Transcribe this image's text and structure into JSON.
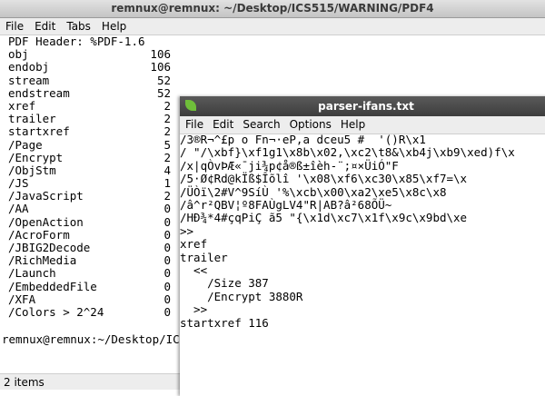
{
  "window": {
    "title": "remnux@remnux: ~/Desktop/ICS515/WARNING/PDF4"
  },
  "menu": {
    "file": "File",
    "edit": "Edit",
    "tabs": "Tabs",
    "help": "Help"
  },
  "terminal": {
    "header": "PDF Header: %PDF-1.6",
    "rows": [
      {
        "key": "obj",
        "value": "106"
      },
      {
        "key": "endobj",
        "value": "106"
      },
      {
        "key": "stream",
        "value": "52"
      },
      {
        "key": "endstream",
        "value": "52"
      },
      {
        "key": "xref",
        "value": "2"
      },
      {
        "key": "trailer",
        "value": "2"
      },
      {
        "key": "startxref",
        "value": "2"
      },
      {
        "key": "/Page",
        "value": "5"
      },
      {
        "key": "/Encrypt",
        "value": "2"
      },
      {
        "key": "/ObjStm",
        "value": "4"
      },
      {
        "key": "/JS",
        "value": "1"
      },
      {
        "key": "/JavaScript",
        "value": "2"
      },
      {
        "key": "/AA",
        "value": "0"
      },
      {
        "key": "/OpenAction",
        "value": "0"
      },
      {
        "key": "/AcroForm",
        "value": "0"
      },
      {
        "key": "/JBIG2Decode",
        "value": "0"
      },
      {
        "key": "/RichMedia",
        "value": "0"
      },
      {
        "key": "/Launch",
        "value": "0"
      },
      {
        "key": "/EmbeddedFile",
        "value": "0"
      },
      {
        "key": "/XFA",
        "value": "0"
      },
      {
        "key": "/Colors > 2^24",
        "value": "0"
      }
    ],
    "prompt": "remnux@remnux:~/Desktop/ICS"
  },
  "status": {
    "text": "2 items"
  },
  "editor": {
    "title": "parser-ifans.txt",
    "menu": {
      "file": "File",
      "edit": "Edit",
      "search": "Search",
      "options": "Options",
      "help": "Help"
    },
    "lines": [
      "/3®R¬^£p o Fn¬·eP,a dceu5 #  '()R\\x1",
      "/ \"/\\xbf}\\xf1g1\\x8b\\x02,\\xc2\\t8&\\xb4j\\xb9\\xed)f\\x",
      "/x|qÒvÞÆ«¯ji¾p¢å®ß±îèh-¨;¤×ÜiÓ\"F",
      "/5·Ø¢Rd@kÏß$Îõlî '\\x08\\xf6\\xc30\\x85\\xf7=\\x",
      "/ÜÒï\\2#V^9SíÙ '%\\xcb\\x00\\xa2\\xe5\\x8c\\x8",
      "/â^r²QBV¦º8FAÙgLV4\"R|AB?â²68ÕÜ~",
      "/HÐ¾*4#çqPiÇ ã5 \"{\\x1d\\xc7\\x1f\\x9c\\x9bd\\xe",
      ">>",
      "",
      "",
      "xref",
      "",
      "trailer",
      "  <<",
      "    /Size 387",
      "    /Encrypt 3880R",
      "  >>",
      "",
      "startxref 116"
    ]
  }
}
